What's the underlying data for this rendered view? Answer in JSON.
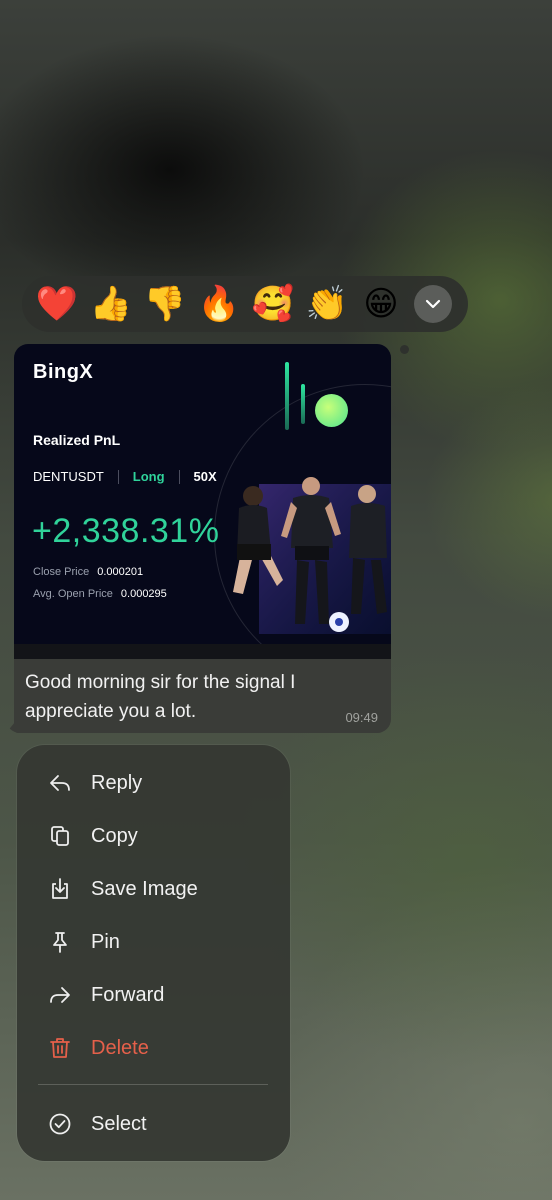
{
  "reactions": {
    "emojis": [
      {
        "char": "❤️",
        "name": "red-heart"
      },
      {
        "char": "👍",
        "name": "thumbs-up"
      },
      {
        "char": "👎",
        "name": "thumbs-down"
      },
      {
        "char": "🔥",
        "name": "fire"
      },
      {
        "char": "🥰",
        "name": "smiling-face-with-hearts"
      },
      {
        "char": "👏",
        "name": "clapping-hands"
      },
      {
        "char": "😁",
        "name": "beaming-face"
      }
    ],
    "more_icon": "chevron-down-icon"
  },
  "message": {
    "image": {
      "brand": "BingX",
      "title": "Realized PnL",
      "pair": "DENTUSDT",
      "direction": "Long",
      "leverage": "50X",
      "pnl_percent": "+2,338.31%",
      "close_price_label": "Close Price",
      "close_price": "0.000201",
      "avg_open_label": "Avg. Open Price",
      "avg_open": "0.000295",
      "colors": {
        "accent": "#30d39a",
        "background": "#06081a"
      }
    },
    "text": "Good morning sir for the signal I appreciate you a lot.",
    "time": "09:49"
  },
  "menu": {
    "items": [
      {
        "label": "Reply",
        "icon": "reply-icon"
      },
      {
        "label": "Copy",
        "icon": "copy-icon"
      },
      {
        "label": "Save Image",
        "icon": "save-image-icon"
      },
      {
        "label": "Pin",
        "icon": "pin-icon"
      },
      {
        "label": "Forward",
        "icon": "forward-icon"
      },
      {
        "label": "Delete",
        "icon": "trash-icon",
        "color": "#e5604a"
      },
      {
        "label": "Select",
        "icon": "check-circle-icon"
      }
    ]
  }
}
